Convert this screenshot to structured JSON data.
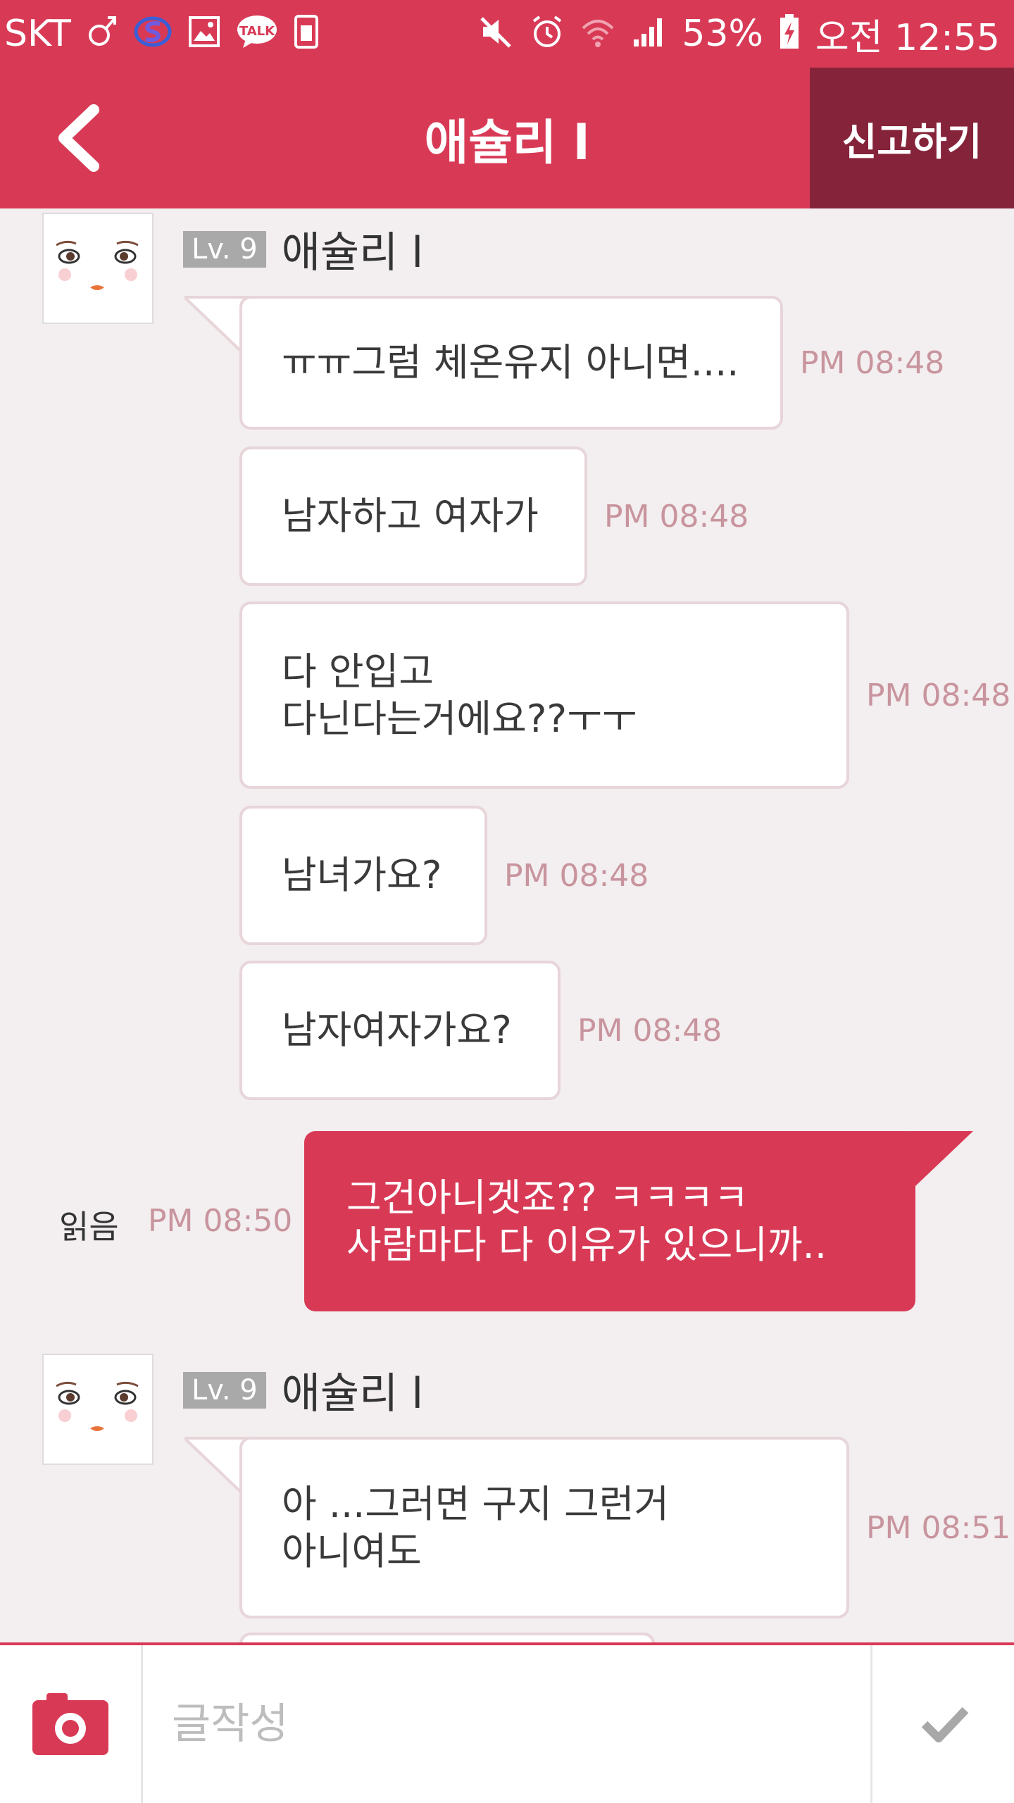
{
  "status_bar": {
    "carrier": "SKT",
    "battery": "53%",
    "time": "오전 12:55",
    "icons": [
      "gender-icon",
      "s-app-icon",
      "gallery-icon",
      "talk-icon",
      "sim-icon",
      "mute-icon",
      "alarm-icon",
      "wifi-icon",
      "signal-icon",
      "battery-charging-icon"
    ],
    "talk_label": "TALK"
  },
  "header": {
    "title": "애슐리 l",
    "report_label": "신고하기",
    "back_icon": "chevron-left-icon"
  },
  "colors": {
    "accent": "#d83a56",
    "accent_dark": "#85233a",
    "background": "#f3eeef",
    "bubble_border": "#e7d5d9",
    "time_text": "#c8949e"
  },
  "chat": {
    "groups": [
      {
        "sender": {
          "level": "Lv. 9",
          "name": "애슐리 l"
        },
        "messages": [
          {
            "lines": [
              "ㅠㅠ그럼 체온유지 아니면...."
            ],
            "time": "PM 08:48"
          },
          {
            "lines": [
              "남자하고 여자가"
            ],
            "time": "PM 08:48"
          },
          {
            "lines": [
              "다 안입고",
              "다닌다는거에요??ㅜㅜ"
            ],
            "time": "PM 08:48"
          },
          {
            "lines": [
              "남녀가요?"
            ],
            "time": "PM 08:48"
          },
          {
            "lines": [
              "남자여자가요?"
            ],
            "time": "PM 08:48"
          }
        ]
      },
      {
        "outgoing": {
          "lines": [
            "그건아니겟죠?? ㅋㅋㅋㅋ",
            "사람마다 다 이유가 있으니까.."
          ],
          "time": "PM 08:50",
          "read": "읽음"
        }
      },
      {
        "sender": {
          "level": "Lv. 9",
          "name": "애슐리 l"
        },
        "messages": [
          {
            "lines": [
              "아 ...그러면 구지 그런거",
              "아니여도"
            ],
            "time": "PM 08:51"
          }
        ]
      }
    ]
  },
  "input_bar": {
    "placeholder": "글작성",
    "camera_icon": "camera-icon",
    "send_icon": "checkmark-icon"
  }
}
